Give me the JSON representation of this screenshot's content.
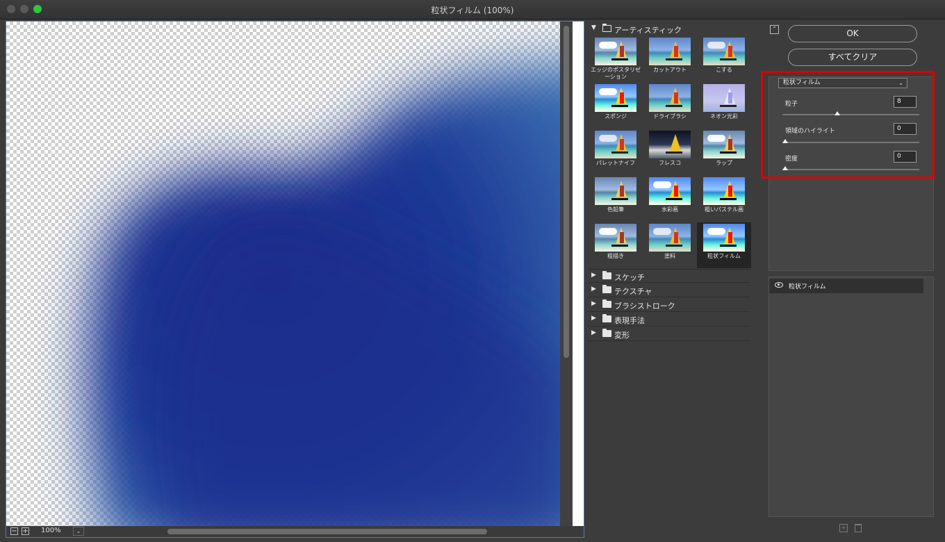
{
  "window": {
    "title": "粒状フィルム (100%)"
  },
  "preview": {
    "zoom": "100%"
  },
  "gallery": {
    "open_category": "アーティスティック",
    "filters": [
      "エッジのポスタリゼーション",
      "カットアウト",
      "こする",
      "スポンジ",
      "ドライブラシ",
      "ネオン光彩",
      "パレットナイフ",
      "フレスコ",
      "ラップ",
      "色鉛筆",
      "水彩画",
      "粗いパステル画",
      "粗描き",
      "塗料",
      "粒状フィルム"
    ],
    "selected_filter": "粒状フィルム",
    "categories": [
      "スケッチ",
      "テクスチャ",
      "ブラシストローク",
      "表現手法",
      "変形"
    ]
  },
  "actions": {
    "ok": "OK",
    "clear_all": "すべてクリア"
  },
  "settings": {
    "filter": "粒状フィルム",
    "params": [
      {
        "label": "粒子",
        "value": "8",
        "fraction": 0.4
      },
      {
        "label": "領域のハイライト",
        "value": "0",
        "fraction": 0.0
      },
      {
        "label": "密度",
        "value": "0",
        "fraction": 0.0
      }
    ]
  },
  "layers": {
    "items": [
      "粒状フィルム"
    ]
  }
}
